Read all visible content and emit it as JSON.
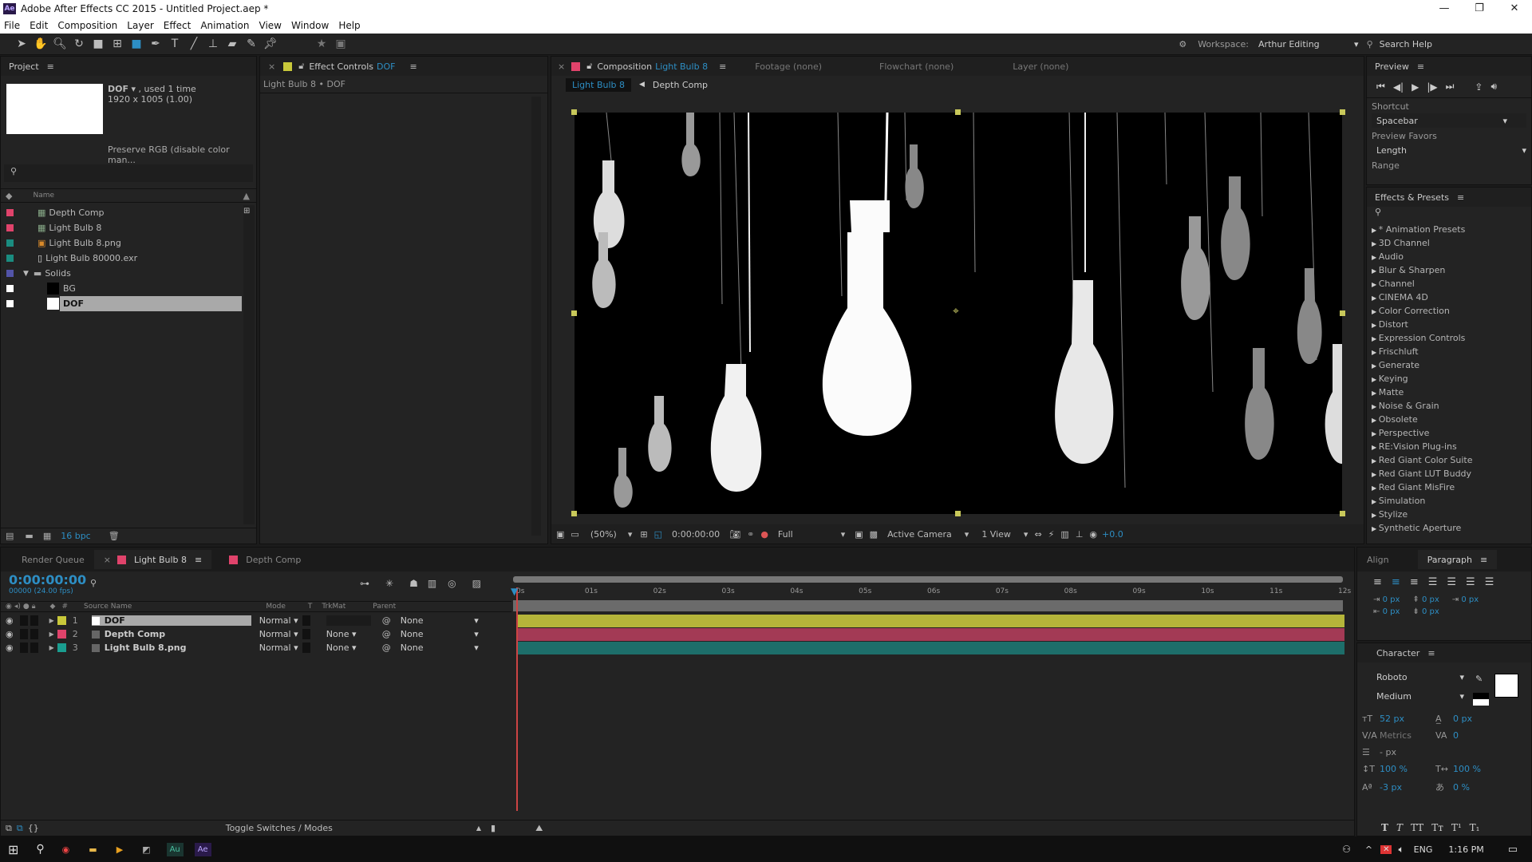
{
  "window": {
    "title": "Adobe After Effects CC 2015 - Untitled Project.aep *",
    "app_badge": "Ae"
  },
  "menu": [
    "File",
    "Edit",
    "Composition",
    "Layer",
    "Effect",
    "Animation",
    "View",
    "Window",
    "Help"
  ],
  "toolbar": {
    "tools": [
      "selection-tool",
      "hand-tool",
      "zoom-tool",
      "rotation-tool",
      "camera-tool",
      "pan-behind-tool",
      "rectangle-tool",
      "pen-tool",
      "type-tool",
      "brush-tool",
      "clone-stamp-tool",
      "eraser-tool",
      "roto-brush-tool",
      "puppet-pin-tool"
    ],
    "workspace_label": "Workspace:",
    "workspace_value": "Arthur Editing",
    "search_help": "Search Help"
  },
  "project": {
    "title": "Project",
    "selected_name": "DOF",
    "used": ", used 1 time",
    "dimensions": "1920 x 1005 (1.00)",
    "color_note": "Preserve RGB (disable color man...",
    "column_name": "Name",
    "items": [
      {
        "name": "Depth Comp",
        "label_color": "#e0436b",
        "icon": "composition-icon",
        "indent": 0
      },
      {
        "name": "Light Bulb 8",
        "label_color": "#e0436b",
        "icon": "composition-icon",
        "indent": 0
      },
      {
        "name": "Light Bulb 8.png",
        "label_color": "#1a8c80",
        "icon": "image-icon",
        "indent": 0
      },
      {
        "name": "Light Bulb 80000.exr",
        "label_color": "#1a8c80",
        "icon": "file-icon",
        "indent": 0
      },
      {
        "name": "Solids",
        "label_color": "#5254a8",
        "icon": "folder-icon",
        "indent": 0
      },
      {
        "name": "BG",
        "label_color": "#ffffff",
        "icon": "solid-black-icon",
        "indent": 1
      },
      {
        "name": "DOF",
        "label_color": "#ffffff",
        "icon": "solid-white-icon",
        "indent": 1
      }
    ],
    "bpc": "16 bpc"
  },
  "effect_controls": {
    "title": "Effect Controls",
    "layer": "DOF",
    "breadcrumb": "Light Bulb 8 • DOF"
  },
  "composition": {
    "tab_label": "Composition",
    "comp_name": "Light Bulb 8",
    "other_tabs": [
      "Footage (none)",
      "Flowchart (none)",
      "Layer (none)"
    ],
    "nav": [
      "Light Bulb 8",
      "Depth Comp"
    ],
    "footer": {
      "zoom": "(50%)",
      "timecode": "0:00:00:00",
      "resolution": "Full",
      "camera": "Active Camera",
      "views": "1 View",
      "exposure": "+0.0"
    }
  },
  "preview": {
    "title": "Preview",
    "shortcut_label": "Shortcut",
    "shortcut_value": "Spacebar",
    "favors_label": "Preview Favors",
    "favors_value": "Length",
    "range_label": "Range"
  },
  "effects_presets": {
    "title": "Effects & Presets",
    "items": [
      "* Animation Presets",
      "3D Channel",
      "Audio",
      "Blur & Sharpen",
      "Channel",
      "CINEMA 4D",
      "Color Correction",
      "Distort",
      "Expression Controls",
      "Frischluft",
      "Generate",
      "Keying",
      "Matte",
      "Noise & Grain",
      "Obsolete",
      "Perspective",
      "RE:Vision Plug-ins",
      "Red Giant Color Suite",
      "Red Giant LUT Buddy",
      "Red Giant MisFire",
      "Simulation",
      "Stylize",
      "Synthetic Aperture"
    ]
  },
  "timeline": {
    "tabs": [
      "Render Queue",
      "Light Bulb 8",
      "Depth Comp"
    ],
    "timecode": "0:00:00:00",
    "frame_info": "00000 (24.00 fps)",
    "columns": {
      "source": "Source Name",
      "mode": "Mode",
      "t": "T",
      "trkmat": "TrkMat",
      "parent": "Parent"
    },
    "ruler": [
      "0s",
      "01s",
      "02s",
      "03s",
      "04s",
      "05s",
      "06s",
      "07s",
      "08s",
      "09s",
      "10s",
      "11s",
      "12s"
    ],
    "layers": [
      {
        "num": "1",
        "name": "DOF",
        "label_color": "#c8c83a",
        "mode": "Normal",
        "trkmat": "",
        "parent": "None",
        "bar_color": "#b5b53a"
      },
      {
        "num": "2",
        "name": "Depth Comp",
        "label_color": "#e0436b",
        "mode": "Normal",
        "trkmat": "None",
        "parent": "None",
        "bar_color": "#a33a55"
      },
      {
        "num": "3",
        "name": "Light Bulb 8.png",
        "label_color": "#1a9e90",
        "mode": "Normal",
        "trkmat": "None",
        "parent": "None",
        "bar_color": "#1d6e6a"
      }
    ],
    "toggle_label": "Toggle Switches / Modes"
  },
  "paragraph": {
    "tabs": [
      "Align",
      "Paragraph"
    ],
    "indent_left": "0 px",
    "indent_first": "0 px",
    "space_before": "0 px",
    "indent_right": "0 px",
    "space_after": "0 px"
  },
  "character": {
    "title": "Character",
    "font": "Roboto",
    "style": "Medium",
    "size": "52 px",
    "leading": "0 px",
    "kerning": "Metrics",
    "tracking": "0",
    "stroke": "- px",
    "vscale": "100 %",
    "hscale": "100 %",
    "baseline": "-3 px",
    "tsume": "0 %"
  },
  "taskbar": {
    "lang": "ENG",
    "time": "1:16 PM",
    "apps": [
      "chrome",
      "explorer",
      "media-player",
      "unity",
      "Au",
      "Ae"
    ]
  }
}
